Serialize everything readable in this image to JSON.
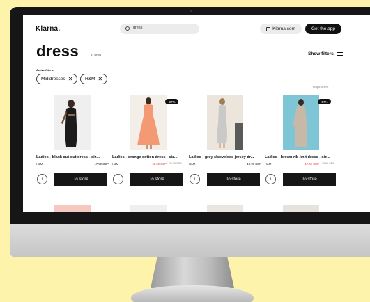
{
  "app": {
    "logo": "Klarna.",
    "search_value": "dress",
    "klarna_com_label": "Klarna.com",
    "get_app_label": "Get the app"
  },
  "results": {
    "title": "dress",
    "count": "31 items",
    "show_filters_label": "Show filters",
    "active_filters_label": "Active filters:",
    "filters": [
      "Mididresses",
      "H&M"
    ],
    "sort_label": "Popularity"
  },
  "products": [
    {
      "name": "Ladies - black cut-out dress - siz...",
      "brand": "H&M",
      "price": "17.99 GBP",
      "old_price": "",
      "discount": "",
      "image": "woman-black-dress",
      "info": "i",
      "cta": "To store"
    },
    {
      "name": "Ladies - orange cotton dress - siz...",
      "brand": "H&M",
      "price": "22.00 GBP",
      "old_price": "34.99 GBP",
      "discount": "-37%",
      "image": "woman-orange-dress",
      "info": "i",
      "cta": "To store"
    },
    {
      "name": "Ladies - grey sleeveless jersey dr...",
      "brand": "H&M",
      "price": "12.99 GBP",
      "old_price": "",
      "discount": "",
      "image": "woman-grey-dress",
      "info": "i",
      "cta": "To store"
    },
    {
      "name": "Ladies - brown rib-knit dress - siz...",
      "brand": "H&M",
      "price": "17.00 GBP",
      "old_price": "39.99 GBP",
      "discount": "-57%",
      "image": "woman-brown-dress",
      "info": "i",
      "cta": "To store"
    }
  ],
  "colors": {
    "page_bg": "#fdf3ab",
    "sale_red": "#e04646",
    "button_dark": "#161616"
  }
}
